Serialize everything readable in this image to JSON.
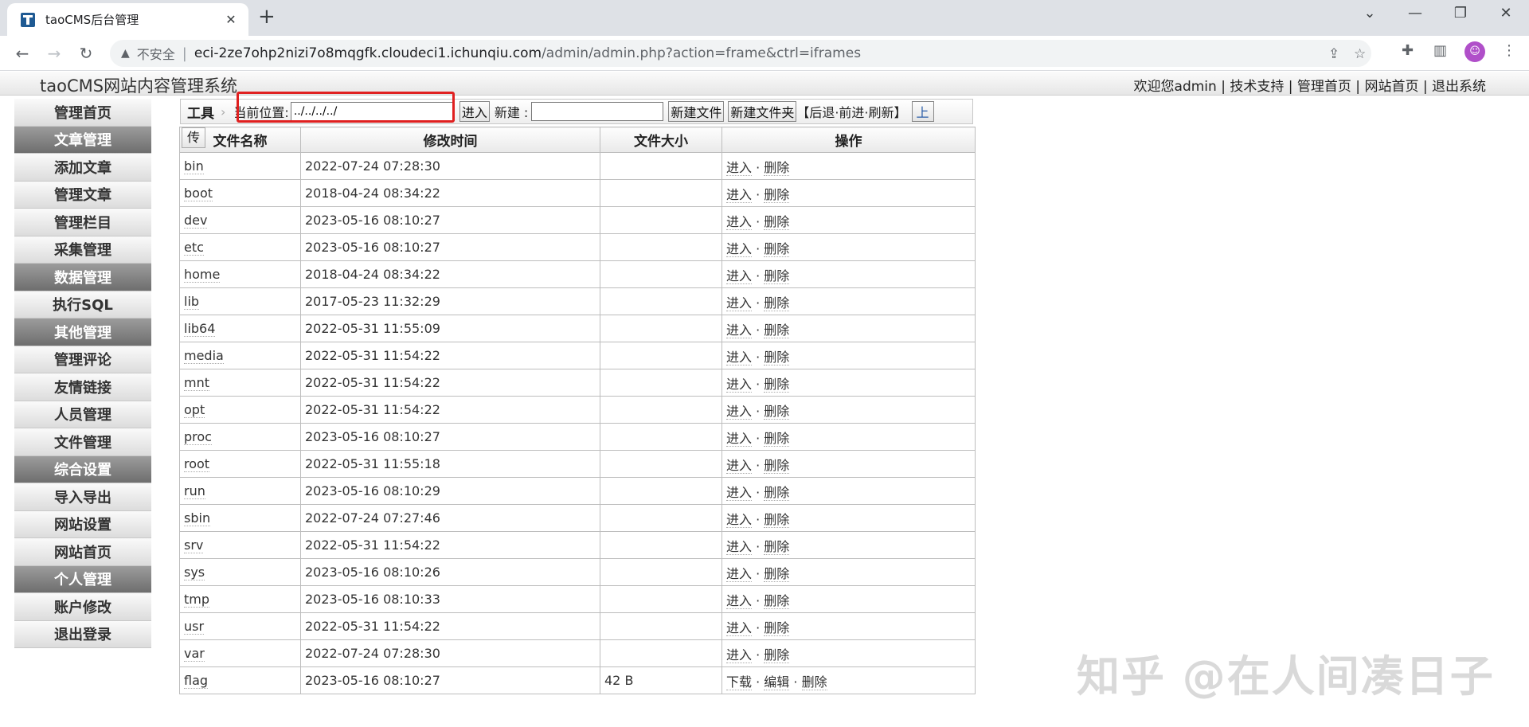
{
  "browser": {
    "tab_title": "taoCMS后台管理",
    "tab_close": "✕",
    "new_tab": "+",
    "insecure_label": "不安全",
    "url_host": "eci-2ze7ohp2nizi7o8mqgfk.cloudeci1.ichunqiu.com",
    "url_path": "/admin/admin.php?action=frame&ctrl=iframes"
  },
  "header": {
    "title": "taoCMS网站内容管理系统",
    "links": [
      "欢迎您admin",
      "技术支持",
      "管理首页",
      "网站首页",
      "退出系统"
    ]
  },
  "sidebar": {
    "items": [
      {
        "label": "管理首页",
        "group": false
      },
      {
        "label": "文章管理",
        "group": true
      },
      {
        "label": "添加文章",
        "group": false
      },
      {
        "label": "管理文章",
        "group": false
      },
      {
        "label": "管理栏目",
        "group": false
      },
      {
        "label": "采集管理",
        "group": false
      },
      {
        "label": "数据管理",
        "group": true
      },
      {
        "label": "执行SQL",
        "group": false
      },
      {
        "label": "其他管理",
        "group": true
      },
      {
        "label": "管理评论",
        "group": false
      },
      {
        "label": "友情链接",
        "group": false
      },
      {
        "label": "人员管理",
        "group": false
      },
      {
        "label": "文件管理",
        "group": false
      },
      {
        "label": "综合设置",
        "group": true
      },
      {
        "label": "导入导出",
        "group": false
      },
      {
        "label": "网站设置",
        "group": false
      },
      {
        "label": "网站首页",
        "group": false
      },
      {
        "label": "个人管理",
        "group": true
      },
      {
        "label": "账户修改",
        "group": false
      },
      {
        "label": "退出登录",
        "group": false
      }
    ]
  },
  "tools": {
    "label": "工具",
    "location_label": "当前位置:",
    "location_value": "../../../../",
    "enter_button": "进入",
    "new_label": "新建 :",
    "new_file_button": "新建文件",
    "new_folder_button": "新建文件夹",
    "history": "【后退·前进·刷新】",
    "up_button": "上",
    "upload_tab": "传"
  },
  "table": {
    "headers": [
      "文件名称",
      "修改时间",
      "文件大小",
      "操作"
    ],
    "rows": [
      {
        "name": "bin",
        "time": "2022-07-24 07:28:30",
        "size": "",
        "ops": [
          "进入",
          "删除"
        ]
      },
      {
        "name": "boot",
        "time": "2018-04-24 08:34:22",
        "size": "",
        "ops": [
          "进入",
          "删除"
        ]
      },
      {
        "name": "dev",
        "time": "2023-05-16 08:10:27",
        "size": "",
        "ops": [
          "进入",
          "删除"
        ]
      },
      {
        "name": "etc",
        "time": "2023-05-16 08:10:27",
        "size": "",
        "ops": [
          "进入",
          "删除"
        ]
      },
      {
        "name": "home",
        "time": "2018-04-24 08:34:22",
        "size": "",
        "ops": [
          "进入",
          "删除"
        ]
      },
      {
        "name": "lib",
        "time": "2017-05-23 11:32:29",
        "size": "",
        "ops": [
          "进入",
          "删除"
        ]
      },
      {
        "name": "lib64",
        "time": "2022-05-31 11:55:09",
        "size": "",
        "ops": [
          "进入",
          "删除"
        ]
      },
      {
        "name": "media",
        "time": "2022-05-31 11:54:22",
        "size": "",
        "ops": [
          "进入",
          "删除"
        ]
      },
      {
        "name": "mnt",
        "time": "2022-05-31 11:54:22",
        "size": "",
        "ops": [
          "进入",
          "删除"
        ]
      },
      {
        "name": "opt",
        "time": "2022-05-31 11:54:22",
        "size": "",
        "ops": [
          "进入",
          "删除"
        ]
      },
      {
        "name": "proc",
        "time": "2023-05-16 08:10:27",
        "size": "",
        "ops": [
          "进入",
          "删除"
        ]
      },
      {
        "name": "root",
        "time": "2022-05-31 11:55:18",
        "size": "",
        "ops": [
          "进入",
          "删除"
        ]
      },
      {
        "name": "run",
        "time": "2023-05-16 08:10:29",
        "size": "",
        "ops": [
          "进入",
          "删除"
        ]
      },
      {
        "name": "sbin",
        "time": "2022-07-24 07:27:46",
        "size": "",
        "ops": [
          "进入",
          "删除"
        ]
      },
      {
        "name": "srv",
        "time": "2022-05-31 11:54:22",
        "size": "",
        "ops": [
          "进入",
          "删除"
        ]
      },
      {
        "name": "sys",
        "time": "2023-05-16 08:10:26",
        "size": "",
        "ops": [
          "进入",
          "删除"
        ]
      },
      {
        "name": "tmp",
        "time": "2023-05-16 08:10:33",
        "size": "",
        "ops": [
          "进入",
          "删除"
        ]
      },
      {
        "name": "usr",
        "time": "2022-05-31 11:54:22",
        "size": "",
        "ops": [
          "进入",
          "删除"
        ]
      },
      {
        "name": "var",
        "time": "2022-07-24 07:28:30",
        "size": "",
        "ops": [
          "进入",
          "删除"
        ]
      },
      {
        "name": "flag",
        "time": "2023-05-16 08:10:27",
        "size": "42 B",
        "ops": [
          "下载",
          "编辑",
          "删除"
        ]
      }
    ]
  },
  "watermark": "知乎 @在人间凑日子",
  "colors": {
    "highlight": "#e02020",
    "group_bg": "#7f7f7f",
    "avatar": "#b04fc9"
  }
}
